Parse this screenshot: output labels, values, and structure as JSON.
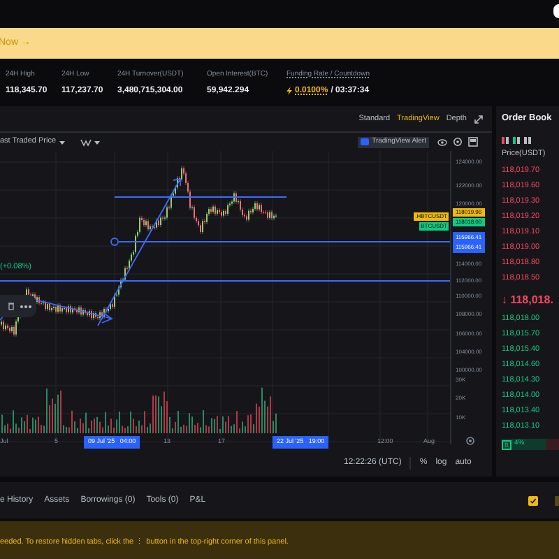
{
  "banner": {
    "text": "Now →"
  },
  "stats": [
    {
      "label": "24H High",
      "value": "118,345.70"
    },
    {
      "label": "24H Low",
      "value": "117,237.70"
    },
    {
      "label": "24H Turnover(USDT)",
      "value": "3,480,715,304.00"
    },
    {
      "label": "Open Interest(BTC)",
      "value": "59,942.294"
    }
  ],
  "funding": {
    "label": "Funding Rate / Countdown",
    "rate": "0.0100%",
    "countdown": "/ 03:37:34"
  },
  "chart_views": [
    {
      "label": "Standard",
      "selected": false
    },
    {
      "label": "TradingView",
      "selected": true
    },
    {
      "label": "Depth",
      "selected": false
    }
  ],
  "price_source": "ast Traded Price",
  "alert_button": "TradingView Alert",
  "change": "(+0.08%)",
  "price_axis": [
    "124000.00",
    "122000.00",
    "120000.00",
    "114000.00",
    "112000.00",
    "110000.00",
    "108000.00",
    "106000.00",
    "104000.00",
    "100000.00"
  ],
  "price_tags": [
    {
      "label": ".HBTCUSDT",
      "value": "118019.96",
      "color": "#f0b90b"
    },
    {
      "label": "BTCUSDT",
      "value": "118018.00",
      "color": "#0ecb81"
    }
  ],
  "cursor_prices": [
    "115966.41",
    "115966.41"
  ],
  "volume_axis": [
    "30K",
    "20K",
    "10K"
  ],
  "time_axis": [
    {
      "text": "Jul",
      "kind": "tick"
    },
    {
      "text": "5",
      "kind": "tick"
    },
    {
      "text": "09 Jul '25   04:00",
      "kind": "cursor"
    },
    {
      "text": "13",
      "kind": "tick"
    },
    {
      "text": "17",
      "kind": "tick"
    },
    {
      "text": "22 Jul '25   19:00",
      "kind": "cursor"
    },
    {
      "text": "12:00",
      "kind": "tick"
    },
    {
      "text": "Aug",
      "kind": "tick"
    }
  ],
  "clock": "12:22:26 (UTC)",
  "scale_buttons": [
    "%",
    "log",
    "auto"
  ],
  "order_book": {
    "title": "Order Book",
    "column": "Price(USDT)",
    "asks": [
      "118,019.70",
      "118,019.60",
      "118,019.30",
      "118,019.20",
      "118,019.10",
      "118,019.00",
      "118,018.80",
      "118,018.50"
    ],
    "last_price": "↓ 118,018.",
    "bids": [
      "118,018.00",
      "118,015.70",
      "118,015.40",
      "118,014.60",
      "118,014.30",
      "118,014.00",
      "118,013.40",
      "118,013.10"
    ],
    "buy_label": "B",
    "buy_share": "4%"
  },
  "bottom_tabs": [
    "e History",
    "Assets",
    "Borrowings (0)",
    "Tools (0)",
    "P&L"
  ],
  "checkbox": {
    "checked": true
  },
  "notice": "eeded. To restore hidden tabs, click the ⋮ button in the top-right corner of this panel."
}
